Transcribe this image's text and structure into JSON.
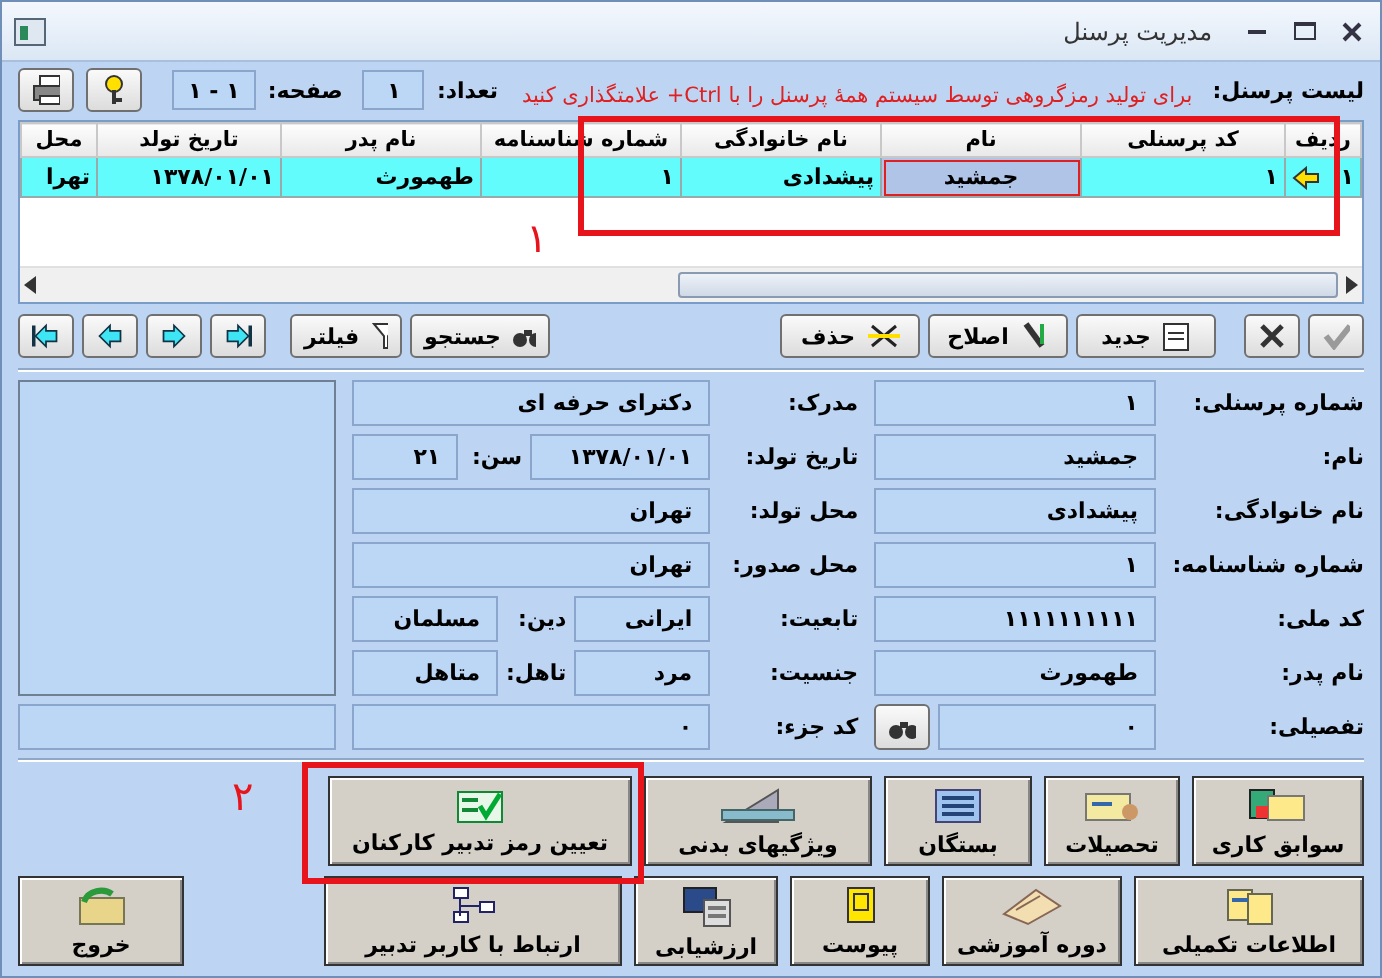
{
  "window": {
    "title": "مدیریت پرسنل"
  },
  "header": {
    "list_label": "لیست پرسنل:",
    "count_label": "تعداد:",
    "count": "۱",
    "page_label": "صفحه:",
    "page": "۱ - ۱",
    "note": "برای تولید رمزگروهی توسط سیستم همهٔ پرسنل را با Ctrl+ علامتگذاری کنید"
  },
  "table": {
    "columns": [
      "ردیف",
      "کد پرسنلی",
      "نام",
      "نام خانوادگی",
      "شماره شناسنامه",
      "نام پدر",
      "تاریخ تولد",
      "محل"
    ],
    "rows": [
      {
        "selected": true,
        "cells": [
          {
            "text": "۱",
            "selected": false
          },
          {
            "text": "۱",
            "selected": false
          },
          {
            "text": "جمشید",
            "selected": true
          },
          {
            "text": "پیشدادی",
            "selected": false
          },
          {
            "text": "۱",
            "selected": false
          },
          {
            "text": "طهمورث",
            "selected": false
          },
          {
            "text": "۱۳۷۸/۰۱/۰۱",
            "selected": false
          },
          {
            "text": "تهرا",
            "selected": false
          }
        ]
      }
    ]
  },
  "toolbar": {
    "state_buttons": [
      {
        "kind": "confirm",
        "disabled": true
      },
      {
        "kind": "cancel",
        "disabled": false
      }
    ],
    "actions": [
      "جدید",
      "اصلاح",
      "حذف"
    ],
    "search": [
      "جستجو",
      "فیلتر"
    ]
  },
  "form": {
    "right": [
      {
        "label": "شماره پرسنلی:",
        "value": "۱"
      },
      {
        "label": "نام:",
        "value": "جمشید"
      },
      {
        "label": "نام خانوادگی:",
        "value": "پیشدادی"
      },
      {
        "label": "شماره شناسنامه:",
        "value": "۱"
      },
      {
        "label": "کد ملی:",
        "value": "۱۱۱۱۱۱۱۱۱۱"
      },
      {
        "label": "نام پدر:",
        "value": "طهمورث"
      },
      {
        "label": "تفصیلی:",
        "value": "۰",
        "kind": "lookup"
      }
    ],
    "middle": [
      {
        "label": "مدرک:",
        "value": "دکترای حرفه ای"
      },
      {
        "label": "تاریخ تولد:",
        "value": "۱۳۷۸/۰۱/۰۱",
        "sub_label": "سن:",
        "sub_value": "۲۱"
      },
      {
        "label": "محل تولد:",
        "value": "تهران"
      },
      {
        "label": "محل صدور:",
        "value": "تهران"
      },
      {
        "label": "تابعیت:",
        "value": "ایرانی",
        "sub_label": "دین:",
        "sub_value": "مسلمان"
      },
      {
        "label": "جنسیت:",
        "value": "مرد",
        "sub_label": "تاهل:",
        "sub_value": "متاهل"
      },
      {
        "label": "کد جزء:",
        "value": "۰"
      }
    ]
  },
  "buttons_row1": [
    "سوابق کاری",
    "تحصیلات",
    "بستگان",
    "ویژگیهای بدنی",
    "تعیین رمز تدبیر کارکنان"
  ],
  "buttons_row2": [
    "اطلاعات تکمیلی",
    "دوره آموزشی",
    "پیوست",
    "ارزشیابی",
    "ارتباط با کاربر تدبیر"
  ],
  "exit": "خروج",
  "annotations": {
    "grid_marker": "۱",
    "button_marker": "۲"
  }
}
